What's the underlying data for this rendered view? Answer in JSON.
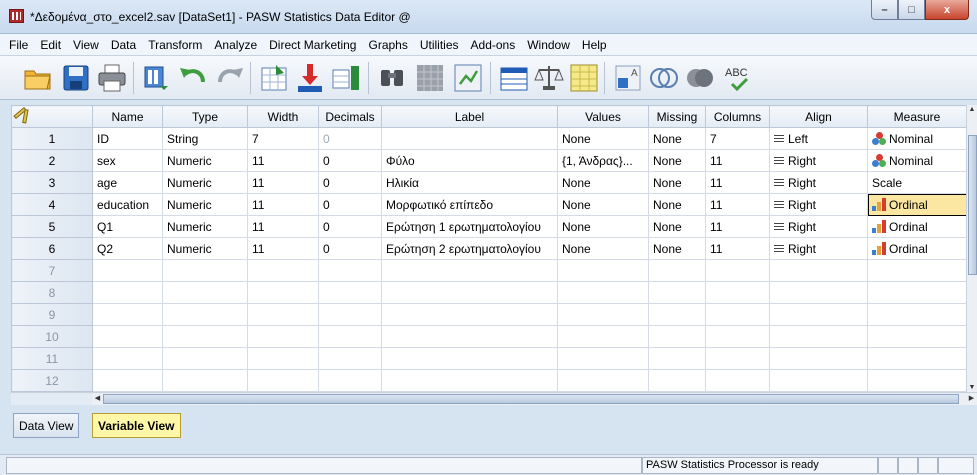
{
  "window": {
    "title": "*Δεδομένα_στο_excel2.sav [DataSet1] - PASW Statistics Data Editor @",
    "controls": {
      "minimize": "–",
      "maximize": "□",
      "close": "x"
    }
  },
  "menu": [
    {
      "label": "File",
      "name": "menu-file"
    },
    {
      "label": "Edit",
      "name": "menu-edit"
    },
    {
      "label": "View",
      "name": "menu-view"
    },
    {
      "label": "Data",
      "name": "menu-data"
    },
    {
      "label": "Transform",
      "name": "menu-transform"
    },
    {
      "label": "Analyze",
      "name": "menu-analyze"
    },
    {
      "label": "Direct Marketing",
      "name": "menu-direct-marketing"
    },
    {
      "label": "Graphs",
      "name": "menu-graphs"
    },
    {
      "label": "Utilities",
      "name": "menu-utilities"
    },
    {
      "label": "Add-ons",
      "name": "menu-add-ons"
    },
    {
      "label": "Window",
      "name": "menu-window"
    },
    {
      "label": "Help",
      "name": "menu-help"
    }
  ],
  "toolbar": {
    "buttons": [
      "open-folder-icon",
      "save-disk-icon",
      "print-icon",
      "recall-dialog-icon",
      "undo-icon",
      "redo-icon",
      "go-to-case-icon",
      "go-to-variable-icon",
      "variables-icon",
      "find-icon",
      "insert-cases-icon",
      "insert-variable-icon",
      "split-file-icon",
      "weight-cases-icon",
      "select-cases-icon",
      "value-labels-icon",
      "use-sets-icon",
      "show-all-variables-icon",
      "spell-check-icon"
    ],
    "spell_label": "ABC"
  },
  "grid": {
    "columns": [
      "Name",
      "Type",
      "Width",
      "Decimals",
      "Label",
      "Values",
      "Missing",
      "Columns",
      "Align",
      "Measure"
    ],
    "rows": [
      {
        "num": "1",
        "name": "ID",
        "type": "String",
        "width": "7",
        "decimals": "0",
        "label": "",
        "values": "None",
        "missing": "None",
        "columns": "7",
        "align": "Left",
        "measure": "Nominal"
      },
      {
        "num": "2",
        "name": "sex",
        "type": "Numeric",
        "width": "11",
        "decimals": "0",
        "label": "Φύλο",
        "values": "{1, Άνδρας}...",
        "missing": "None",
        "columns": "11",
        "align": "Right",
        "measure": "Nominal"
      },
      {
        "num": "3",
        "name": "age",
        "type": "Numeric",
        "width": "11",
        "decimals": "0",
        "label": "Ηλικία",
        "values": "None",
        "missing": "None",
        "columns": "11",
        "align": "Right",
        "measure": "Scale"
      },
      {
        "num": "4",
        "name": "education",
        "type": "Numeric",
        "width": "11",
        "decimals": "0",
        "label": "Μορφωτικό επίπεδο",
        "values": "None",
        "missing": "None",
        "columns": "11",
        "align": "Right",
        "measure": "Ordinal"
      },
      {
        "num": "5",
        "name": "Q1",
        "type": "Numeric",
        "width": "11",
        "decimals": "0",
        "label": "Ερώτηση 1 ερωτηματολογίου",
        "values": "None",
        "missing": "None",
        "columns": "11",
        "align": "Right",
        "measure": "Ordinal"
      },
      {
        "num": "6",
        "name": "Q2",
        "type": "Numeric",
        "width": "11",
        "decimals": "0",
        "label": "Ερώτηση 2 ερωτηματολογίου",
        "values": "None",
        "missing": "None",
        "columns": "11",
        "align": "Right",
        "measure": "Ordinal"
      }
    ],
    "empty_rows": [
      "7",
      "8",
      "9",
      "10",
      "11",
      "12"
    ],
    "selected_cell": {
      "row": "4",
      "column": "Measure"
    }
  },
  "tabs": {
    "data_view": "Data View",
    "variable_view": "Variable View",
    "active": "Variable View"
  },
  "status": {
    "processor": "PASW Statistics Processor is ready"
  },
  "colors": {
    "active_tab": "#fef7a8",
    "selected_cell": "#fce7a2",
    "chrome": "#d6e3f1"
  }
}
